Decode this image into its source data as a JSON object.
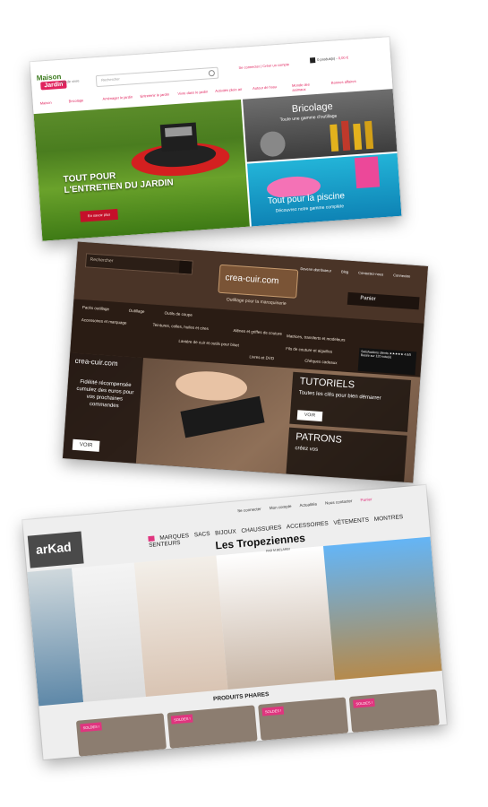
{
  "card1": {
    "logo": {
      "line1": "Maison",
      "line2": "Jardin",
      "tag": "l'art de vivre"
    },
    "search_placeholder": "Rechercher",
    "account": "Se connecter | Créer un compte",
    "cart": "0 produit(s) - ",
    "cart_amount": "0,00 €",
    "nav": [
      "Maison",
      "Bricolage",
      "Aménager le jardin",
      "Entretenir le jardin",
      "Vivre dans le jardin",
      "Activités plein air",
      "Autour de l'eau",
      "Monde des animaux",
      "Bonnes affaires"
    ],
    "hero_line1": "TOUT POUR",
    "hero_line2": "L'ENTRETIEN DU JARDIN",
    "hero_button": "En savoir plus",
    "brico_title": "Bricolage",
    "brico_sub": "Toute une gamme d'outillage",
    "pool_title": "Tout pour la piscine",
    "pool_sub": "Découvrez notre gamme complète"
  },
  "card2": {
    "search_placeholder": "Rechercher",
    "logo": "crea-cuir.com",
    "tagline": "Outillage pour la maroquinerie",
    "top_links": [
      "Devenir distributeur",
      "Blog",
      "Contactez-nous",
      "Connexion"
    ],
    "panier": "Panier",
    "nav": [
      "Packs outillage",
      "Outillage",
      "Outils de coupe",
      "Accessoires et marquage",
      "Teintures, colles, huiles et cires",
      "Alênes et griffes de couture",
      "Matrices, transferts et modeleurs",
      "Fils de couture et aiguilles",
      "Lanière de cuir et outils pour biset",
      "Livres et DVD",
      "Chèques cadeaux"
    ],
    "badge": "Satisfactions clients ★★★★★ 4.8/5 Basée sur 120 note(s)",
    "left_logo": "crea-cuir.com",
    "left_text": "Fidélité récompensée cumulez des euros pour vos prochaines commandes",
    "voir": "VOIR",
    "tut_title": "TUTORIELS",
    "tut_text": "Toutes les clés pour bien démarrer",
    "pat_title": "PATRONS",
    "pat_text": "créez vos"
  },
  "card3": {
    "logo": "arKad",
    "account": [
      "Se connecter",
      "Mon compte",
      "Actualités",
      "Nous contacter"
    ],
    "panier": "Panier",
    "menu": [
      "MARQUES",
      "SACS",
      "BIJOUX",
      "CHAUSSURES",
      "ACCESSOIRES",
      "VÊTEMENTS",
      "MONTRES",
      "SENTEURS"
    ],
    "brand_title": "Les Tropeziennes",
    "brand_sub": "PAR M.BELARBI",
    "section": "PRODUITS PHARES",
    "sale_badge": "SOLDES !"
  },
  "colors": {
    "pink": "#e0357f",
    "red": "#c5102a",
    "leather": "#3b2a20"
  }
}
